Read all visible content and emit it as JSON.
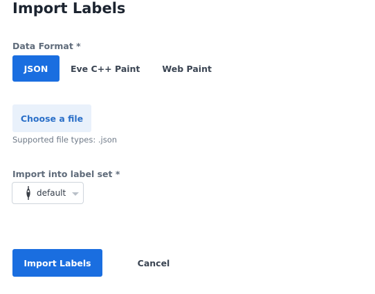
{
  "dialog": {
    "title": "Import Labels"
  },
  "data_format": {
    "label": "Data Format *",
    "options": [
      {
        "label": "JSON",
        "selected": true
      },
      {
        "label": "Eve C++ Paint",
        "selected": false
      },
      {
        "label": "Web Paint",
        "selected": false
      }
    ]
  },
  "file_upload": {
    "button_label": "Choose a file",
    "hint": "Supported file types: .json"
  },
  "label_set": {
    "label": "Import into label set *",
    "selected_value": "default",
    "icon": "label-pin-icon"
  },
  "actions": {
    "import_label": "Import Labels",
    "cancel_label": "Cancel"
  },
  "colors": {
    "primary": "#1a6ee0",
    "secondary_bg": "#e9f1fb",
    "secondary_text": "#2a6fc8"
  }
}
